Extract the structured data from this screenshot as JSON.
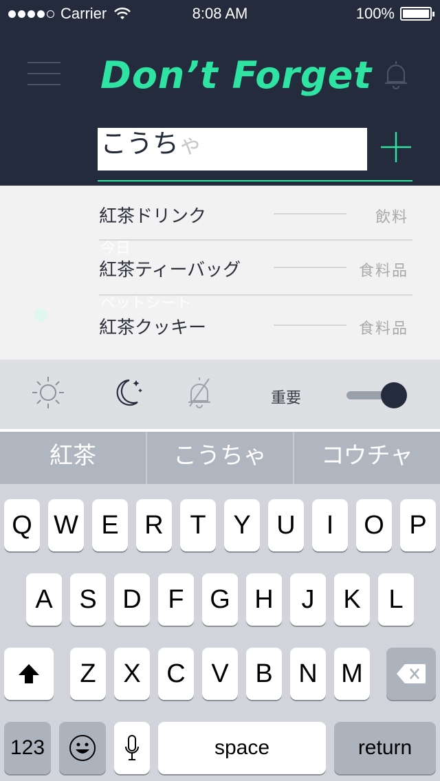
{
  "status_bar": {
    "carrier": "Carrier",
    "time": "8:08 AM",
    "battery": "100%"
  },
  "header": {
    "title": "Don’t Forget",
    "menu_icon": "hamburger-menu-icon",
    "bell_icon": "bell-icon"
  },
  "input": {
    "value": "こうち",
    "marked_text": "ゃ",
    "add_icon": "plus-icon"
  },
  "suggestions": {
    "ghost_texts": [
      "今日",
      "ペットシート"
    ],
    "items": [
      {
        "name": "紅茶ドリンク",
        "category": "飲料"
      },
      {
        "name": "紅茶ティーバッグ",
        "category": "食料品"
      },
      {
        "name": "紅茶クッキー",
        "category": "食料品"
      }
    ]
  },
  "toolbar": {
    "icons": [
      "sun-icon",
      "moon-icon",
      "bell-off-icon"
    ],
    "important_label": "重要",
    "important_toggle_on": true
  },
  "candidates": [
    "紅茶",
    "こうちゃ",
    "コウチャ"
  ],
  "keyboard": {
    "row1": [
      "Q",
      "W",
      "E",
      "R",
      "T",
      "Y",
      "U",
      "I",
      "O",
      "P"
    ],
    "row2": [
      "A",
      "S",
      "D",
      "F",
      "G",
      "H",
      "J",
      "K",
      "L"
    ],
    "row3": [
      "Z",
      "X",
      "C",
      "V",
      "B",
      "N",
      "M"
    ],
    "numbers_label": "123",
    "space_label": "space",
    "return_label": "return"
  },
  "colors": {
    "header_bg": "#232b3d",
    "accent": "#2fe3a2"
  }
}
